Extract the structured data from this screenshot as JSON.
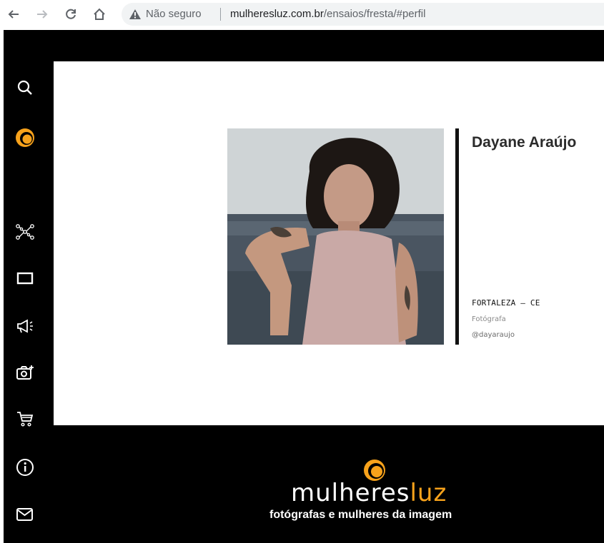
{
  "browser": {
    "security_label": "Não seguro",
    "url_host": "mulheresluz.com.br",
    "url_path": "/ensaios/fresta/#perfil"
  },
  "sidebar": {
    "items": [
      {
        "icon": "search-icon"
      },
      {
        "icon": "logo-icon"
      },
      {
        "icon": "network-icon"
      },
      {
        "icon": "rectangle-icon"
      },
      {
        "icon": "megaphone-icon"
      },
      {
        "icon": "camera-add-icon"
      },
      {
        "icon": "cart-icon"
      },
      {
        "icon": "info-icon"
      },
      {
        "icon": "mail-icon"
      }
    ]
  },
  "profile": {
    "name": "Dayane Araújo",
    "location": "FORTALEZA – CE",
    "role": "Fotógrafa",
    "handle": "@dayaraujo"
  },
  "footer": {
    "brand_left": "mulheres",
    "brand_right": "luz",
    "tagline": "fotógrafas e mulheres da imagem"
  },
  "colors": {
    "accent": "#f7a21b",
    "background": "#000000",
    "panel": "#ffffff"
  }
}
